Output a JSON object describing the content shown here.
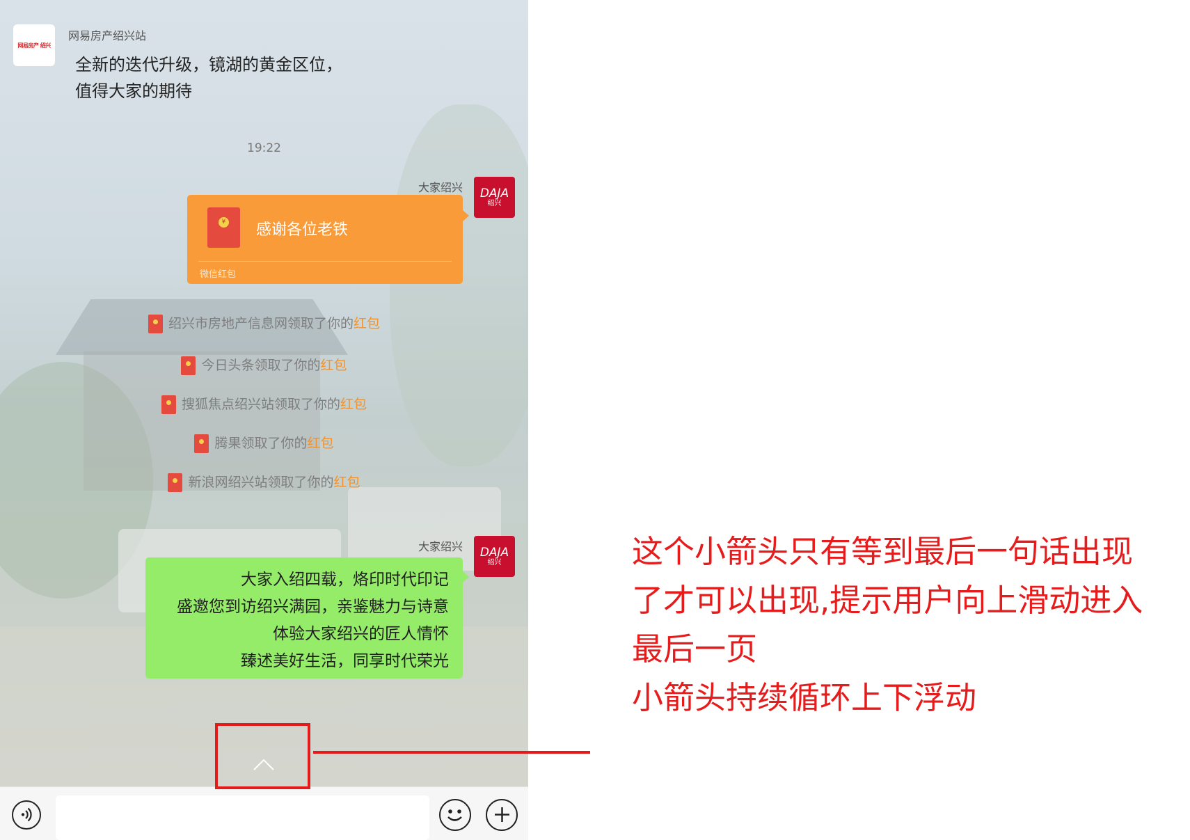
{
  "chat": {
    "header": {
      "avatar_logo": "网易房产 绍兴",
      "sender": "网易房产绍兴站",
      "message": "全新的迭代升级，镜湖的黄金区位，\n值得大家的期待"
    },
    "timestamp": "19:22",
    "self_name": "大家绍兴",
    "self_avatar": {
      "line1": "DAJA",
      "line2": "绍兴"
    },
    "red_packet": {
      "title": "感谢各位老铁",
      "label": "微信红包"
    },
    "claims": [
      {
        "prefix": "绍兴市房地产信息网领取了你的",
        "highlight": "红包"
      },
      {
        "prefix": "今日头条领取了你的",
        "highlight": "红包"
      },
      {
        "prefix": "搜狐焦点绍兴站领取了你的",
        "highlight": "红包"
      },
      {
        "prefix": "腾果领取了你的",
        "highlight": "红包"
      },
      {
        "prefix": "新浪网绍兴站领取了你的",
        "highlight": "红包"
      }
    ],
    "green_message": [
      "大家入绍四载，烙印时代印记",
      "盛邀您到访绍兴满园，亲鉴魅力与诗意",
      "体验大家绍兴的匠人情怀",
      "臻述美好生活，同享时代荣光"
    ],
    "scroll_up_icon": "chevron-up-icon"
  },
  "input_bar": {
    "voice_icon": "voice-icon",
    "input_value": "",
    "emoji_icon": "emoji-icon",
    "plus_icon": "plus-icon"
  },
  "annotation": {
    "lines": [
      "这个小箭头只有等到最后一句话出现",
      "了才可以出现,提示用户向上滑动进入",
      "最后一页",
      "小箭头持续循环上下浮动"
    ],
    "color": "#e61c1c"
  },
  "colors": {
    "red_packet": "#f99b38",
    "green_bubble": "#95ec69",
    "highlight": "#f3922b",
    "annotation_red": "#e31b1b",
    "avatar_red": "#c8102e"
  }
}
